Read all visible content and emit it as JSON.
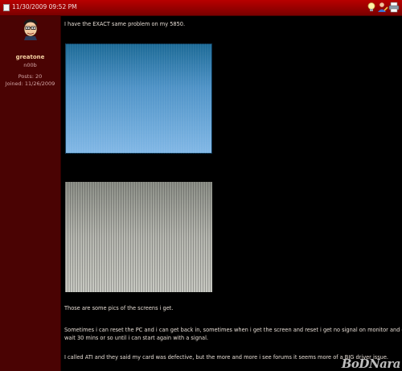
{
  "header": {
    "date": "11/30/2009 09:52 PM",
    "icons": [
      "post-status-icon",
      "lightbulb-icon",
      "user-profile-icon",
      "printer-icon"
    ]
  },
  "user": {
    "name": "greatone",
    "rank": "n00b",
    "posts": "Posts: 20",
    "joined": "Joined: 11/26/2009",
    "avatar_icon": "cartoon-face-avatar"
  },
  "post": {
    "line1": "I have the EXACT same problem on my 5850.",
    "line2": "Those are some pics of the screens i get.",
    "line3": "Sometimes i can reset the PC and i can get back in, sometimes when i get the screen and reset i get no signal on monitor and gotta",
    "line4": "wait 30 mins or so until i can start again with a signal.",
    "line5": "I called ATI and they said my card was defective, but the more and more i see forums it seems more of a BIG driver issue."
  },
  "watermark": "BoDNara",
  "colors": {
    "header": "#9a0000",
    "sidebar": "#4a0303",
    "content_bg": "#000000"
  }
}
